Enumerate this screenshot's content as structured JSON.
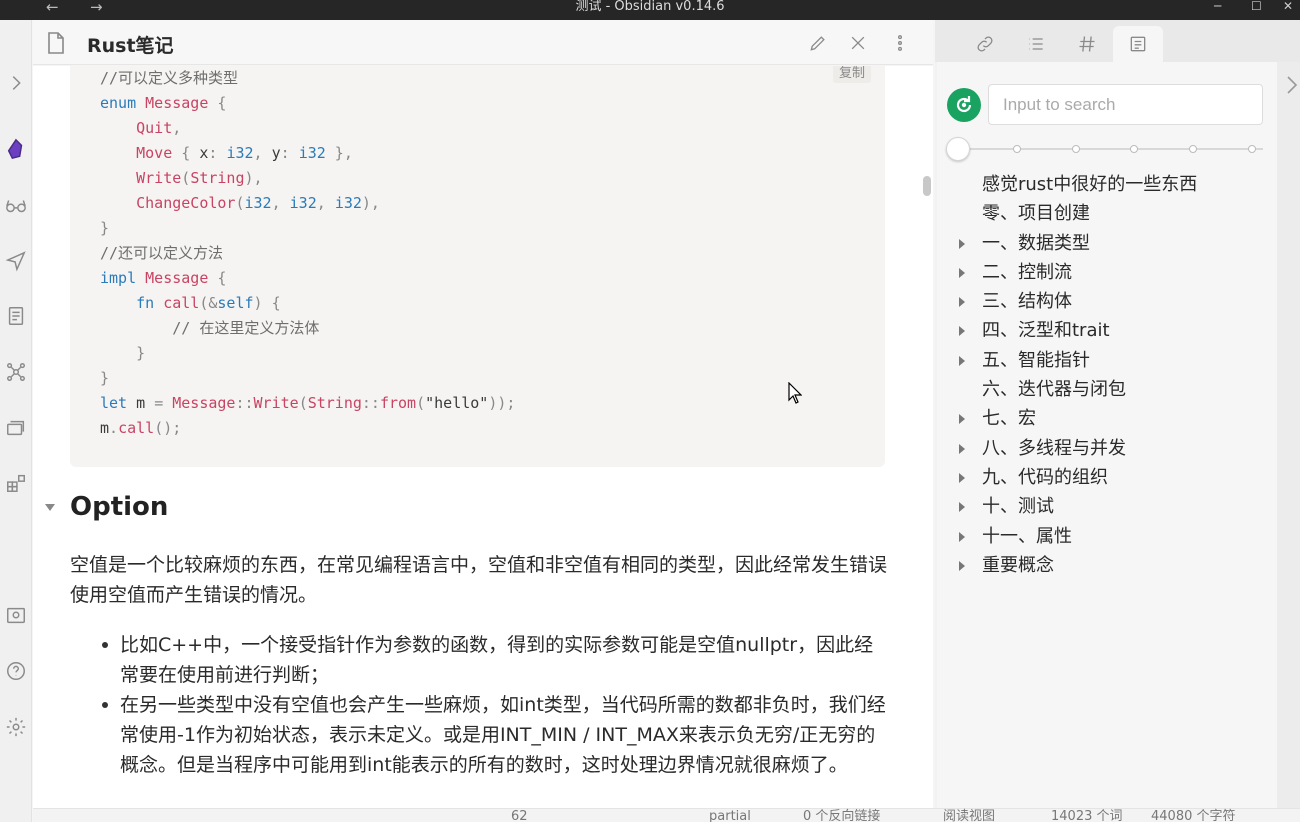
{
  "window": {
    "title": "测试 - Obsidian v0.14.6",
    "back_arrow": "←",
    "forward_arrow": "→",
    "minimize": "─",
    "maximize": "☐",
    "close": "✕"
  },
  "ribbon": {
    "icons": [
      "expand-chevron-icon",
      "obsidian-logo-icon",
      "glasses-icon",
      "send-icon",
      "document-icon",
      "graph-icon",
      "cards-icon",
      "blocks-icon",
      "vault-icon",
      "help-icon",
      "settings-icon"
    ]
  },
  "pane": {
    "title": "Rust笔记",
    "copy_label": "复制",
    "code_lines": [
      {
        "seg": [
          [
            "cm",
            "//可以定义多种类型"
          ]
        ]
      },
      {
        "seg": [
          [
            "k",
            "enum"
          ],
          [
            "s",
            " "
          ],
          [
            "t",
            "Message"
          ],
          [
            "p",
            " {"
          ]
        ]
      },
      {
        "seg": [
          [
            "s",
            "    "
          ],
          [
            "t",
            "Quit"
          ],
          [
            "p",
            ","
          ]
        ]
      },
      {
        "seg": [
          [
            "s",
            "    "
          ],
          [
            "t",
            "Move"
          ],
          [
            "p",
            " { "
          ],
          [
            "s",
            "x"
          ],
          [
            "p",
            ": "
          ],
          [
            "k",
            "i32"
          ],
          [
            "p",
            ", "
          ],
          [
            "s",
            "y"
          ],
          [
            "p",
            ": "
          ],
          [
            "k",
            "i32"
          ],
          [
            "p",
            " },"
          ]
        ]
      },
      {
        "seg": [
          [
            "s",
            "    "
          ],
          [
            "t",
            "Write"
          ],
          [
            "p",
            "("
          ],
          [
            "t",
            "String"
          ],
          [
            "p",
            "),"
          ]
        ]
      },
      {
        "seg": [
          [
            "s",
            "    "
          ],
          [
            "t",
            "ChangeColor"
          ],
          [
            "p",
            "("
          ],
          [
            "k",
            "i32"
          ],
          [
            "p",
            ", "
          ],
          [
            "k",
            "i32"
          ],
          [
            "p",
            ", "
          ],
          [
            "k",
            "i32"
          ],
          [
            "p",
            "),"
          ]
        ]
      },
      {
        "seg": [
          [
            "p",
            "}"
          ]
        ]
      },
      {
        "seg": [
          [
            "cm",
            "//还可以定义方法"
          ]
        ]
      },
      {
        "seg": [
          [
            "k",
            "impl"
          ],
          [
            "s",
            " "
          ],
          [
            "t",
            "Message"
          ],
          [
            "p",
            " {"
          ]
        ]
      },
      {
        "seg": [
          [
            "s",
            "    "
          ],
          [
            "k",
            "fn"
          ],
          [
            "s",
            " "
          ],
          [
            "f",
            "call"
          ],
          [
            "p",
            "(&"
          ],
          [
            "k",
            "self"
          ],
          [
            "p",
            ") {"
          ]
        ]
      },
      {
        "seg": [
          [
            "s",
            "        "
          ],
          [
            "cm",
            "// 在这里定义方法体"
          ]
        ]
      },
      {
        "seg": [
          [
            "s",
            "    "
          ],
          [
            "p",
            "}"
          ]
        ]
      },
      {
        "seg": [
          [
            "p",
            "}"
          ]
        ]
      },
      {
        "seg": [
          [
            "k",
            "let"
          ],
          [
            "s",
            " m "
          ],
          [
            "p",
            "= "
          ],
          [
            "t",
            "Message"
          ],
          [
            "p",
            "::"
          ],
          [
            "t",
            "Write"
          ],
          [
            "p",
            "("
          ],
          [
            "t",
            "String"
          ],
          [
            "p",
            "::"
          ],
          [
            "f",
            "from"
          ],
          [
            "p",
            "("
          ],
          [
            "s",
            "\"hello\""
          ],
          [
            "p",
            "));"
          ]
        ]
      },
      {
        "seg": [
          [
            "s",
            "m"
          ],
          [
            "p",
            "."
          ],
          [
            "f",
            "call"
          ],
          [
            "p",
            "();"
          ]
        ]
      }
    ],
    "heading": "Option",
    "paragraph": "空值是一个比较麻烦的东西，在常见编程语言中，空值和非空值有相同的类型，因此经常发生错误使用空值而产生错误的情况。",
    "bullets": [
      "比如C++中，一个接受指针作为参数的函数，得到的实际参数可能是空值nullptr，因此经常要在使用前进行判断；",
      "在另一些类型中没有空值也会产生一些麻烦，如int类型，当代码所需的数都非负时，我们经常使用-1作为初始状态，表示未定义。或是用INT_MIN / INT_MAX来表示负无穷/正无穷的概念。但是当程序中可能用到int能表示的所有的数时，这时处理边界情况就很麻烦了。"
    ]
  },
  "statusbar": {
    "items": [
      "62",
      "partial",
      "0 个反向链接",
      "阅读视图",
      "14023 个词",
      "44080 个字符"
    ]
  },
  "sidebar": {
    "search_placeholder": "Input to search",
    "slider_level": 0,
    "outline": [
      {
        "label": "感觉rust中很好的一些东西",
        "expandable": false
      },
      {
        "label": "零、项目创建",
        "expandable": false
      },
      {
        "label": "一、数据类型",
        "expandable": true
      },
      {
        "label": "二、控制流",
        "expandable": true
      },
      {
        "label": "三、结构体",
        "expandable": true
      },
      {
        "label": "四、泛型和trait",
        "expandable": true
      },
      {
        "label": "五、智能指针",
        "expandable": true
      },
      {
        "label": "六、迭代器与闭包",
        "expandable": false
      },
      {
        "label": "七、宏",
        "expandable": true
      },
      {
        "label": "八、多线程与并发",
        "expandable": true
      },
      {
        "label": "九、代码的组织",
        "expandable": true
      },
      {
        "label": "十、测试",
        "expandable": true
      },
      {
        "label": "十一、属性",
        "expandable": true
      },
      {
        "label": "重要概念",
        "expandable": true
      }
    ]
  },
  "colors": {
    "accent": "#1aa260",
    "code_keyword": "#2b7bb9",
    "code_type": "#c94363"
  }
}
